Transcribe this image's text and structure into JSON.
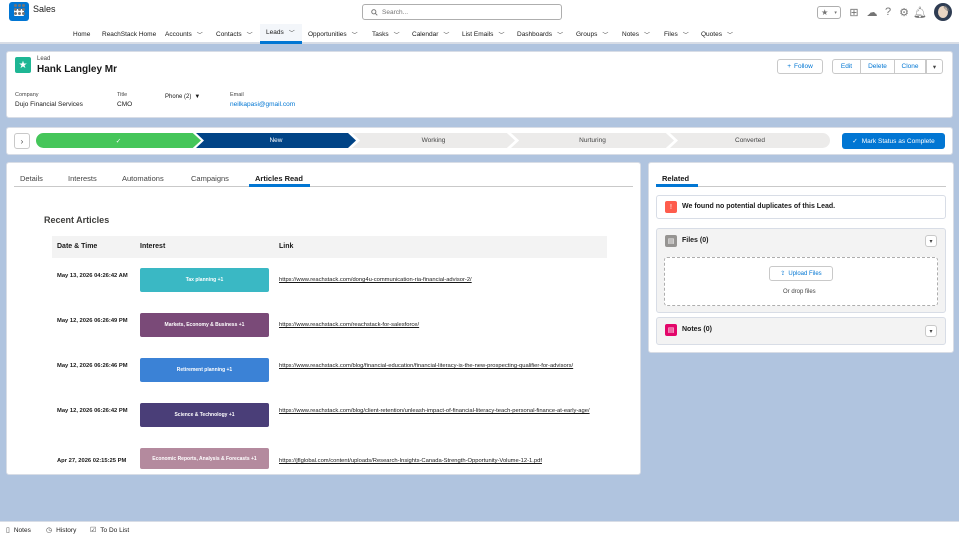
{
  "search": {
    "placeholder": "Search..."
  },
  "app": {
    "name": "Sales"
  },
  "nav": {
    "items": [
      {
        "label": "Home"
      },
      {
        "label": "ReachStack Home"
      },
      {
        "label": "Accounts"
      },
      {
        "label": "Contacts"
      },
      {
        "label": "Leads"
      },
      {
        "label": "Opportunities"
      },
      {
        "label": "Tasks"
      },
      {
        "label": "Calendar"
      },
      {
        "label": "List Emails"
      },
      {
        "label": "Dashboards"
      },
      {
        "label": "Groups"
      },
      {
        "label": "Notes"
      },
      {
        "label": "Files"
      },
      {
        "label": "Quotes"
      }
    ]
  },
  "record": {
    "object_label": "Lead",
    "name": "Hank Langley Mr",
    "follow_label": "Follow",
    "edit_label": "Edit",
    "delete_label": "Delete",
    "clone_label": "Clone",
    "fields": {
      "company_label": "Company",
      "company_value": "Dujo Financial Services",
      "title_label": "Title",
      "title_value": "CMO",
      "phone_label": "Phone (2)",
      "email_label": "Email",
      "email_value": "neilkapasi@gmail.com"
    }
  },
  "path": {
    "stages": [
      {
        "label": "✓",
        "status": "complete"
      },
      {
        "label": "New",
        "status": "current"
      },
      {
        "label": "Working",
        "status": "incomplete"
      },
      {
        "label": "Nurturing",
        "status": "incomplete"
      },
      {
        "label": "Converted",
        "status": "incomplete"
      }
    ],
    "mark_complete_label": "Mark Status as Complete"
  },
  "tabs": [
    {
      "label": "Details"
    },
    {
      "label": "Interests"
    },
    {
      "label": "Automations"
    },
    {
      "label": "Campaigns"
    },
    {
      "label": "Articles Read"
    }
  ],
  "articles": {
    "title": "Recent Articles",
    "headers": {
      "date": "Date & Time",
      "interest": "Interest",
      "link": "Link"
    },
    "rows": [
      {
        "date": "May 13, 2026 04:26:42 AM",
        "interest": "Tax planning +1",
        "color": "#3ab8c4",
        "link": "https://www.reachstack.com/dong4u-communication-ria-financial-advisor-2/"
      },
      {
        "date": "May 12, 2026 06:26:49 PM",
        "interest": "Markets, Economy & Business +1",
        "color": "#7a4a78",
        "link": "https://www.reachstack.com/reachstack-for-salesforce/"
      },
      {
        "date": "May 12, 2026 06:26:46 PM",
        "interest": "Retirement planning +1",
        "color": "#3b82d6",
        "link": "https://www.reachstack.com/blog/financial-education/financial-literacy-is-the-new-prospecting-qualifier-for-advisors/"
      },
      {
        "date": "May 12, 2026 06:26:42 PM",
        "interest": "Science & Technology +1",
        "color": "#4a3e78",
        "link": "https://www.reachstack.com/blog/client-retention/unleash-impact-of-financial-literacy-teach-personal-finance-at-early-age/"
      },
      {
        "date": "Apr 27, 2026 02:15:25 PM",
        "interest": "Economic Reports, Analysis & Forecasts +1",
        "color": "#b48a9e",
        "link": "https://jflglobal.com/content/uploads/Research-Insights-Canada-Strength-Opportunity-Volume-12-1.pdf"
      }
    ]
  },
  "related": {
    "tab_label": "Related",
    "duplicates_text": "We found no potential duplicates of this Lead.",
    "files_title": "Files (0)",
    "upload_label": "Upload Files",
    "drop_text": "Or drop files",
    "notes_title": "Notes (0)"
  },
  "footer": {
    "items": [
      {
        "label": "Notes"
      },
      {
        "label": "History"
      },
      {
        "label": "To Do List"
      }
    ]
  },
  "colors": {
    "brand": "#0176d3",
    "path_complete": "#45c65a",
    "path_current": "#014486",
    "lead_icon": "#1eb694"
  }
}
